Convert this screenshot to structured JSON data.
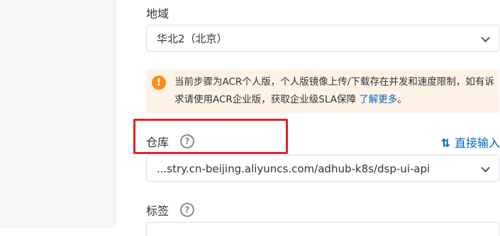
{
  "colors": {
    "accent": "#0064c8",
    "warning": "#f98e1b",
    "notice_bg": "#fff3e8",
    "highlight": "#e0232c"
  },
  "region": {
    "label": "地域",
    "value": "华北2（北京）",
    "chevron_icon": "chevron-down-icon"
  },
  "notice": {
    "icon": "warning-icon",
    "icon_glyph": "!",
    "text": "当前步骤为ACR个人版，个人版镜像上传/下载存在并发和速度限制，如有诉求请使用ACR企业版，获取企业级SLA保障",
    "link": "了解更多",
    "suffix": "。"
  },
  "repository": {
    "label": "仓库",
    "help_icon": "question-circle-icon",
    "help_glyph": "?",
    "direct_input_icon": "swap-vertical-icon",
    "direct_input_glyph": "⇅",
    "direct_input_label": "直接输入",
    "value": "...stry.cn-beijing.aliyuncs.com/adhub-k8s/dsp-ui-api",
    "chevron_icon": "chevron-down-icon"
  },
  "tag": {
    "label": "标签",
    "help_icon": "question-circle-icon",
    "help_glyph": "?"
  }
}
